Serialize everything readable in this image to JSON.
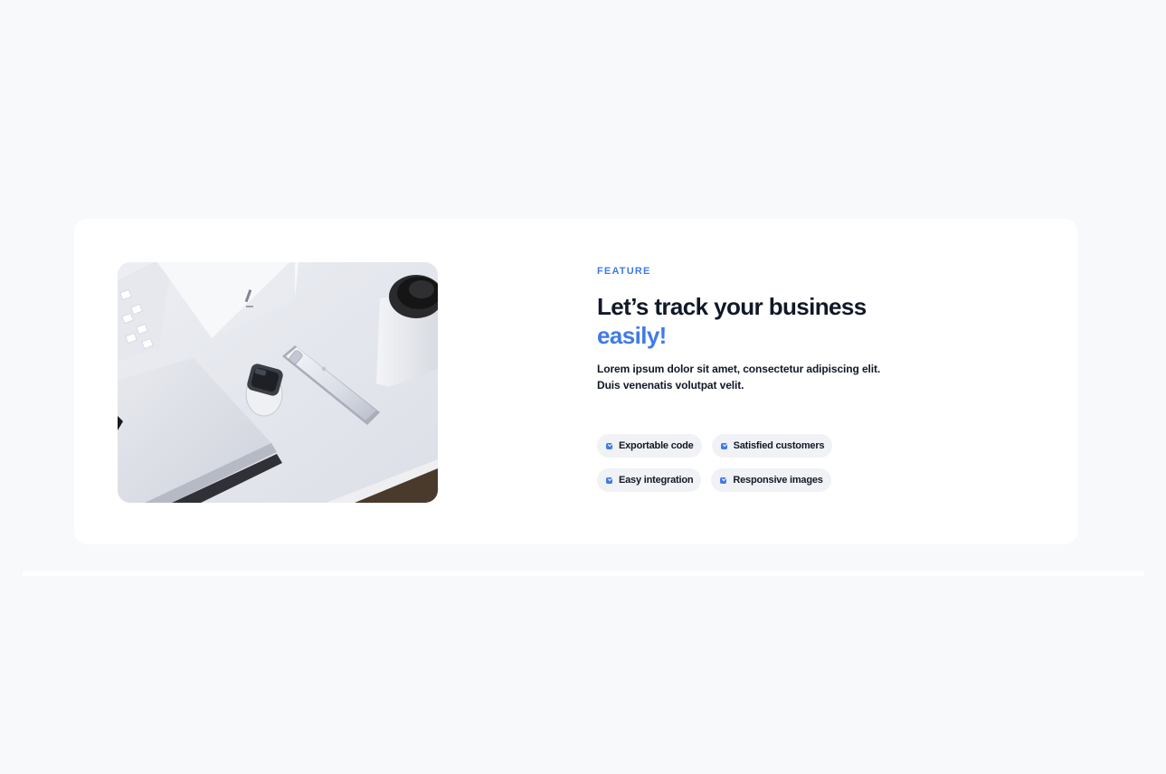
{
  "feature": {
    "eyebrow": "FEATURE",
    "headline": "Let’s track your business",
    "headline_accent": "easily!",
    "description": "Lorem ipsum dolor sit amet, consectetur adipiscing elit. Duis venenatis volutpat velit.",
    "image_alt": "Desk with laptop, smartwatch, smartphone and coffee cup"
  },
  "chips": [
    {
      "label": "Exportable code",
      "icon": "check-icon"
    },
    {
      "label": "Satisfied customers",
      "icon": "check-icon"
    },
    {
      "label": "Easy integration",
      "icon": "check-icon"
    },
    {
      "label": "Responsive images",
      "icon": "check-icon"
    }
  ],
  "colors": {
    "accent": "#3f7be8",
    "text": "#111827",
    "background": "#f8f9fb",
    "card": "#ffffff",
    "chip": "#f1f2f5"
  }
}
